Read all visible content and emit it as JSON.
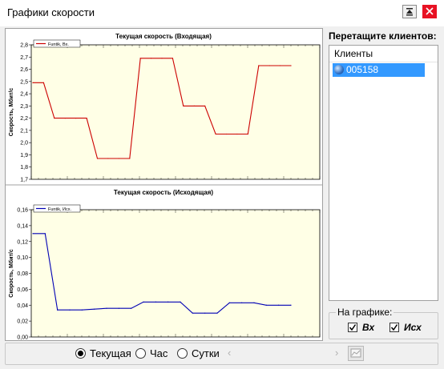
{
  "window": {
    "title": "Графики скорости"
  },
  "charts": [
    {
      "title": "Текущая скорость (Входящая)",
      "ylabel": "Скорость, Мбит/с",
      "legend": "Funtik, Вх.",
      "color": "#cc0000",
      "yticks": [
        "2,8",
        "2,7",
        "2,6",
        "2,5",
        "2,4",
        "2,3",
        "2,2",
        "2,1",
        "2,0",
        "1,9",
        "1,8",
        "1,7"
      ]
    },
    {
      "title": "Текущая скорость (Исходящая)",
      "ylabel": "Скорость, Мбит/с",
      "legend": "Funtik, Исх.",
      "color": "#0000b4",
      "yticks": [
        "0,16",
        "0,14",
        "0,12",
        "0,10",
        "0,08",
        "0,06",
        "0,04",
        "0,02",
        "0,00"
      ]
    }
  ],
  "chart_data": [
    {
      "type": "line",
      "title": "Текущая скорость (Входящая)",
      "ylabel": "Скорость, Мбит/с",
      "ylim": [
        1.7,
        2.8
      ],
      "grid": false,
      "legend_position": "top-left",
      "series": [
        {
          "name": "Funtik, Вх.",
          "values": [
            2.49,
            2.49,
            2.2,
            2.2,
            2.2,
            2.2,
            1.87,
            1.87,
            1.87,
            1.87,
            2.69,
            2.69,
            2.69,
            2.69,
            2.3,
            2.3,
            2.3,
            2.07,
            2.07,
            2.07,
            2.07,
            2.63,
            2.63,
            2.63,
            2.63
          ]
        }
      ]
    },
    {
      "type": "line",
      "title": "Текущая скорость (Исходящая)",
      "ylabel": "Скорость, Мбит/с",
      "ylim": [
        0,
        0.16
      ],
      "grid": false,
      "legend_position": "top-left",
      "series": [
        {
          "name": "Funtik, Исх.",
          "values": [
            0.13,
            0.13,
            0.034,
            0.034,
            0.034,
            0.035,
            0.036,
            0.036,
            0.036,
            0.044,
            0.044,
            0.044,
            0.044,
            0.03,
            0.03,
            0.03,
            0.043,
            0.043,
            0.043,
            0.04,
            0.04,
            0.04
          ]
        }
      ]
    }
  ],
  "clients": {
    "drag_label": "Перетащите клиентов:",
    "header": "Клиенты",
    "items": [
      "005158"
    ]
  },
  "on_chart": {
    "label": "На графике:",
    "in_label": "Вх",
    "out_label": "Исх",
    "in_checked": true,
    "out_checked": true
  },
  "period": {
    "options": [
      "Текущая",
      "Час",
      "Сутки"
    ],
    "selected": 0
  },
  "icons": {
    "pin": "pin-icon",
    "close": "close-icon",
    "client": "client-globe-icon",
    "prev": "chevron-left-icon",
    "next": "chevron-right-icon",
    "export": "chart-export-icon"
  }
}
